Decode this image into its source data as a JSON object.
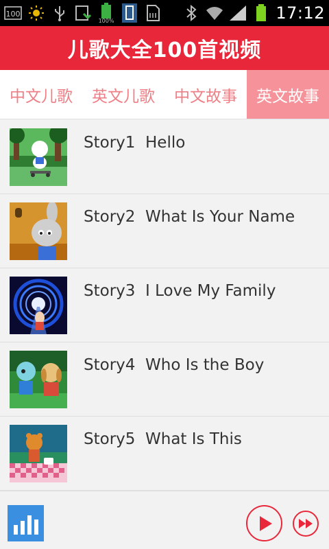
{
  "status_bar": {
    "time": "17:12",
    "battery_percent": "100%",
    "icons": [
      "memory-icon",
      "brightness-icon",
      "usb-icon",
      "sync-icon",
      "battery-charging-icon",
      "phone-icon",
      "sdcard-icon",
      "bluetooth-icon",
      "wifi-icon",
      "signal-icon",
      "battery-icon"
    ]
  },
  "header": {
    "title": "儿歌大全100首视频"
  },
  "tabs": [
    {
      "label": "中文儿歌",
      "active": false
    },
    {
      "label": "英文儿歌",
      "active": false
    },
    {
      "label": "中文故事",
      "active": false
    },
    {
      "label": "英文故事",
      "active": true
    }
  ],
  "stories": [
    {
      "title": "Story1  Hello",
      "thumb": "puppy-skateboard-thumbnail"
    },
    {
      "title": "Story2  What Is Your Name",
      "thumb": "rabbit-thumbnail"
    },
    {
      "title": "Story3  I Love My Family",
      "thumb": "tunnel-thumbnail"
    },
    {
      "title": "Story4  Who Is the Boy",
      "thumb": "friends-thumbnail"
    },
    {
      "title": "Story5  What Is This",
      "thumb": "picnic-thumbnail"
    }
  ],
  "player": {
    "icons": [
      "equalizer-icon",
      "play-icon",
      "fast-forward-icon"
    ]
  },
  "colors": {
    "header_red": "#e8283a",
    "tab_text_pink": "#ef7f86",
    "tab_active_bg": "#f6939a",
    "eq_blue": "#3b8fe0"
  }
}
